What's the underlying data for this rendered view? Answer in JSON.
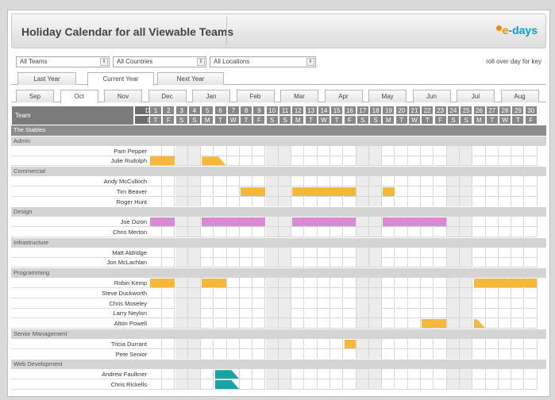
{
  "app": {
    "title": "Holiday Calendar for all Viewable Teams",
    "logo_e": "e",
    "logo_days": "-days"
  },
  "filters": {
    "teams": "All Teams",
    "countries": "All Countries",
    "locations": "All Locations",
    "rollover_hint": "roll over day for key"
  },
  "year_tabs": [
    "Last Year",
    "Current Year",
    "Next Year"
  ],
  "active_year_tab": 1,
  "month_tabs": [
    "Sep",
    "Oct",
    "Nov",
    "Dec",
    "Jan",
    "Feb",
    "Mar",
    "Apr",
    "May",
    "Jun",
    "Jul",
    "Aug"
  ],
  "active_month_tab": 1,
  "header": {
    "team_label": "Team",
    "date_label": "Date",
    "day_label": "Day"
  },
  "dates": [
    "1",
    "2",
    "3",
    "4",
    "5",
    "6",
    "7",
    "8",
    "9",
    "10",
    "11",
    "12",
    "13",
    "14",
    "15",
    "16",
    "17",
    "18",
    "19",
    "20",
    "21",
    "22",
    "23",
    "24",
    "25",
    "26",
    "27",
    "28",
    "29",
    "30"
  ],
  "days": [
    "T",
    "F",
    "S",
    "S",
    "M",
    "T",
    "W",
    "T",
    "F",
    "S",
    "S",
    "M",
    "T",
    "W",
    "T",
    "F",
    "S",
    "S",
    "M",
    "T",
    "W",
    "T",
    "F",
    "S",
    "S",
    "M",
    "T",
    "W",
    "T",
    "F"
  ],
  "colors": {
    "holiday": "#f5b83d",
    "training": "#d88ad3",
    "other": "#1aa3a3"
  },
  "team_name": "The Stables",
  "rows": [
    {
      "kind": "group",
      "label": "Admin"
    },
    {
      "kind": "person",
      "name": "Pam Pepper",
      "leave": []
    },
    {
      "kind": "person",
      "name": "Julie Rudolph",
      "leave": [
        {
          "from": 1,
          "to": 2,
          "type": "holiday"
        },
        {
          "from": 5,
          "to": 6,
          "type": "holiday",
          "half_end": true
        }
      ]
    },
    {
      "kind": "group",
      "label": "Commercial"
    },
    {
      "kind": "person",
      "name": "Andy McCulloch",
      "leave": []
    },
    {
      "kind": "person",
      "name": "Tim Beaver",
      "leave": [
        {
          "from": 8,
          "to": 9,
          "type": "holiday"
        },
        {
          "from": 12,
          "to": 16,
          "type": "holiday"
        },
        {
          "from": 19,
          "to": 19,
          "type": "holiday"
        }
      ]
    },
    {
      "kind": "person",
      "name": "Roger Hunt",
      "leave": []
    },
    {
      "kind": "group",
      "label": "Design"
    },
    {
      "kind": "person",
      "name": "Joe Dizon",
      "leave": [
        {
          "from": 1,
          "to": 2,
          "type": "training"
        },
        {
          "from": 5,
          "to": 9,
          "type": "training"
        },
        {
          "from": 12,
          "to": 16,
          "type": "training"
        },
        {
          "from": 19,
          "to": 23,
          "type": "training"
        }
      ]
    },
    {
      "kind": "person",
      "name": "Chris Merton",
      "leave": []
    },
    {
      "kind": "group",
      "label": "Infrastructure"
    },
    {
      "kind": "person",
      "name": "Matt Aldridge",
      "leave": []
    },
    {
      "kind": "person",
      "name": "Jon McLachlan",
      "leave": []
    },
    {
      "kind": "group",
      "label": "Programming"
    },
    {
      "kind": "person",
      "name": "Robin Kemp",
      "leave": [
        {
          "from": 1,
          "to": 2,
          "type": "holiday"
        },
        {
          "from": 5,
          "to": 6,
          "type": "holiday"
        },
        {
          "from": 26,
          "to": 30,
          "type": "holiday"
        }
      ]
    },
    {
      "kind": "person",
      "name": "Steve Duckworth",
      "leave": []
    },
    {
      "kind": "person",
      "name": "Chris Moseley",
      "leave": []
    },
    {
      "kind": "person",
      "name": "Larry Neylon",
      "leave": []
    },
    {
      "kind": "person",
      "name": "Alton Powell",
      "leave": [
        {
          "from": 22,
          "to": 23,
          "type": "holiday"
        },
        {
          "from": 26,
          "to": 26,
          "type": "holiday",
          "half_end": true
        }
      ]
    },
    {
      "kind": "group",
      "label": "Senior Management"
    },
    {
      "kind": "person",
      "name": "Tricia Durrant",
      "leave": [
        {
          "from": 16,
          "to": 16,
          "type": "holiday"
        }
      ]
    },
    {
      "kind": "person",
      "name": "Pete Senior",
      "leave": []
    },
    {
      "kind": "group",
      "label": "Web Development"
    },
    {
      "kind": "person",
      "name": "Andrew Faulkner",
      "leave": [
        {
          "from": 6,
          "to": 7,
          "type": "other",
          "half_end": true
        }
      ]
    },
    {
      "kind": "person",
      "name": "Chris Rickells",
      "leave": [
        {
          "from": 6,
          "to": 7,
          "type": "other",
          "half_end": true
        }
      ]
    }
  ]
}
